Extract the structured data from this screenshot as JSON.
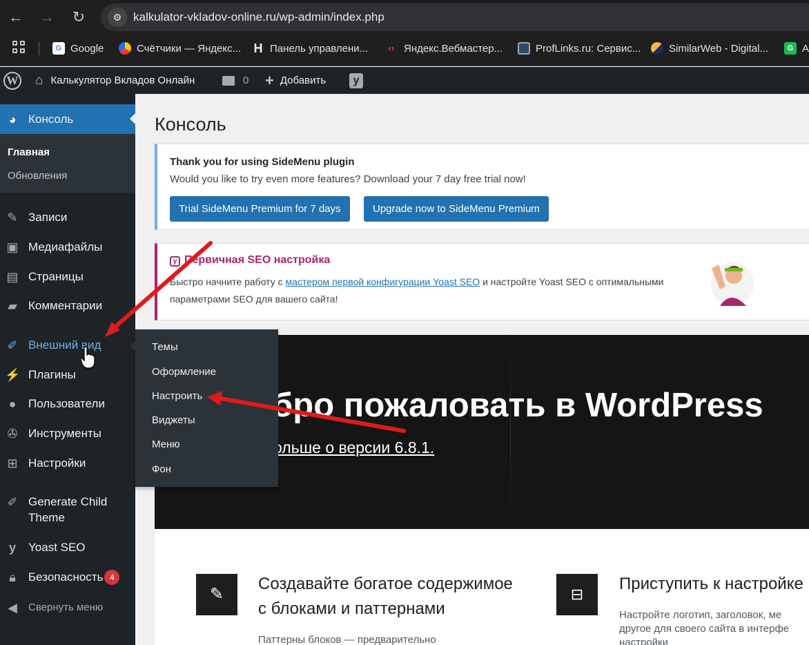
{
  "browser": {
    "url": "kalkulator-vkladov-online.ru/wp-admin/index.php",
    "bookmarks": [
      {
        "label": "Google",
        "icon": "google-icon",
        "color": "#ffffff"
      },
      {
        "label": "Счётчики — Яндекс...",
        "icon": "metrica-icon",
        "color": "#ffcc00"
      },
      {
        "label": "Панель управлени...",
        "icon": "h-icon",
        "color": "#ffffff"
      },
      {
        "label": "Яндекс.Вебмастер...",
        "icon": "code-brackets-icon",
        "color": "#ff3333"
      },
      {
        "label": "ProfLinks.ru: Сервис...",
        "icon": "proflinks-icon",
        "color": "#5aa0e8"
      },
      {
        "label": "SimilarWeb - Digital...",
        "icon": "similarweb-icon",
        "color": "#f8b63c"
      },
      {
        "label": "A",
        "icon": "g-icon",
        "color": "#1db954"
      }
    ]
  },
  "adminbar": {
    "site_name": "Калькулятор Вкладов Онлайн",
    "comments_count": "0",
    "new_label": "Добавить"
  },
  "sidebar": {
    "dashboard": "Консоль",
    "home": "Главная",
    "updates": "Обновления",
    "posts": "Записи",
    "media": "Медиафайлы",
    "pages": "Страницы",
    "comments": "Комментарии",
    "appearance": "Внешний вид",
    "plugins": "Плагины",
    "users": "Пользователи",
    "tools": "Инструменты",
    "settings": "Настройки",
    "child_theme_1": "Generate Child",
    "child_theme_2": "Theme",
    "yoast": "Yoast SEO",
    "security": "Безопасность",
    "security_badge": "4",
    "collapse": "Свернуть меню"
  },
  "appearance_submenu": [
    "Темы",
    "Оформление",
    "Настроить",
    "Виджеты",
    "Меню",
    "Фон"
  ],
  "main": {
    "title": "Консоль",
    "notice": {
      "title": "Thank you for using SideMenu plugin",
      "text": "Would you like to try even more features? Download your 7 day free trial now!",
      "trial_button": "Trial SideMenu Premium for 7 days",
      "upgrade_button": "Upgrade now to SideMenu Premium"
    },
    "seo": {
      "title": "Первичная SEO настройка",
      "text_before": "Быстро начните работу с ",
      "link": "мастером первой конфигурации Yoast SEO",
      "text_after": " и настройте Yoast SEO с оптимальными параметрами SEO для вашего сайта!"
    },
    "welcome": {
      "title": "бро пожаловать в WordPress",
      "link": "ольше о версии 6.8.1."
    },
    "panels": [
      {
        "title_1": "Создавайте богатое содержимое",
        "title_2": "с блоками и паттернами",
        "text": "Паттерны блоков — предварительно"
      },
      {
        "title_1": "Приступить к настройке",
        "text_1": "Настройте логотип, заголовок, ме",
        "text_2": "другое для своего сайта в интерфе",
        "text_3": "настройки"
      }
    ]
  },
  "colors": {
    "admin_blue": "#2271b1",
    "sidebar_bg": "#1d2327",
    "yoast_purple": "#a4286a",
    "annotation_red": "#e01b1b"
  }
}
